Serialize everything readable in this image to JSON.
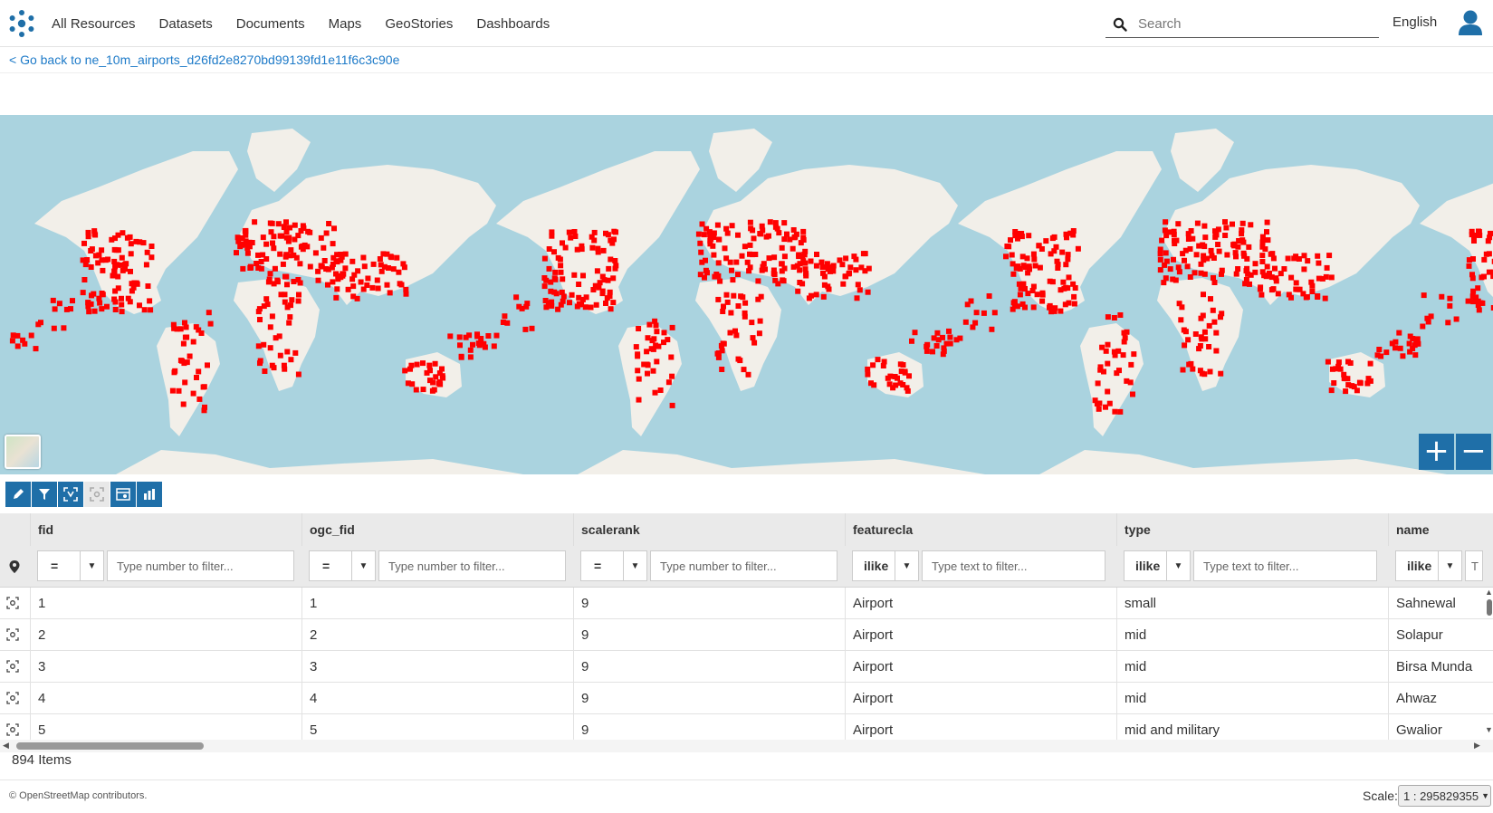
{
  "nav": {
    "items": [
      "All Resources",
      "Datasets",
      "Documents",
      "Maps",
      "GeoStories",
      "Dashboards"
    ],
    "search_placeholder": "Search",
    "language": "English"
  },
  "backlink": "< Go back to ne_10m_airports_d26fd2e8270bd99139fd1e11f6c3c90e",
  "map": {
    "zoom_in": "+",
    "zoom_out": "−",
    "colors": {
      "ocean": "#aad3df",
      "land": "#f2efe9",
      "points": "#ff0000"
    }
  },
  "toolbar": {
    "icons": [
      "edit-icon",
      "filter-icon",
      "zoom-to-selection-icon",
      "zoom-to-features-icon",
      "table-settings-icon",
      "chart-icon"
    ]
  },
  "table": {
    "columns": [
      "fid",
      "ogc_fid",
      "scalerank",
      "featurecla",
      "type",
      "name"
    ],
    "filters": [
      {
        "op": "=",
        "placeholder": "Type number to filter..."
      },
      {
        "op": "=",
        "placeholder": "Type number to filter..."
      },
      {
        "op": "=",
        "placeholder": "Type number to filter..."
      },
      {
        "op": "ilike",
        "placeholder": "Type text to filter..."
      },
      {
        "op": "ilike",
        "placeholder": "Type text to filter..."
      },
      {
        "op": "ilike",
        "placeholder": "T"
      }
    ],
    "rows": [
      [
        "1",
        "1",
        "9",
        "Airport",
        "small",
        "Sahnewal"
      ],
      [
        "2",
        "2",
        "9",
        "Airport",
        "mid",
        "Solapur"
      ],
      [
        "3",
        "3",
        "9",
        "Airport",
        "mid",
        "Birsa Munda"
      ],
      [
        "4",
        "4",
        "9",
        "Airport",
        "mid",
        "Ahwaz"
      ],
      [
        "5",
        "5",
        "9",
        "Airport",
        "mid and military",
        "Gwalior"
      ]
    ],
    "count": "894 Items"
  },
  "footer": {
    "attribution": "© OpenStreetMap contributors.",
    "scale_label": "Scale:",
    "scale_value": "1 : 295829355"
  }
}
